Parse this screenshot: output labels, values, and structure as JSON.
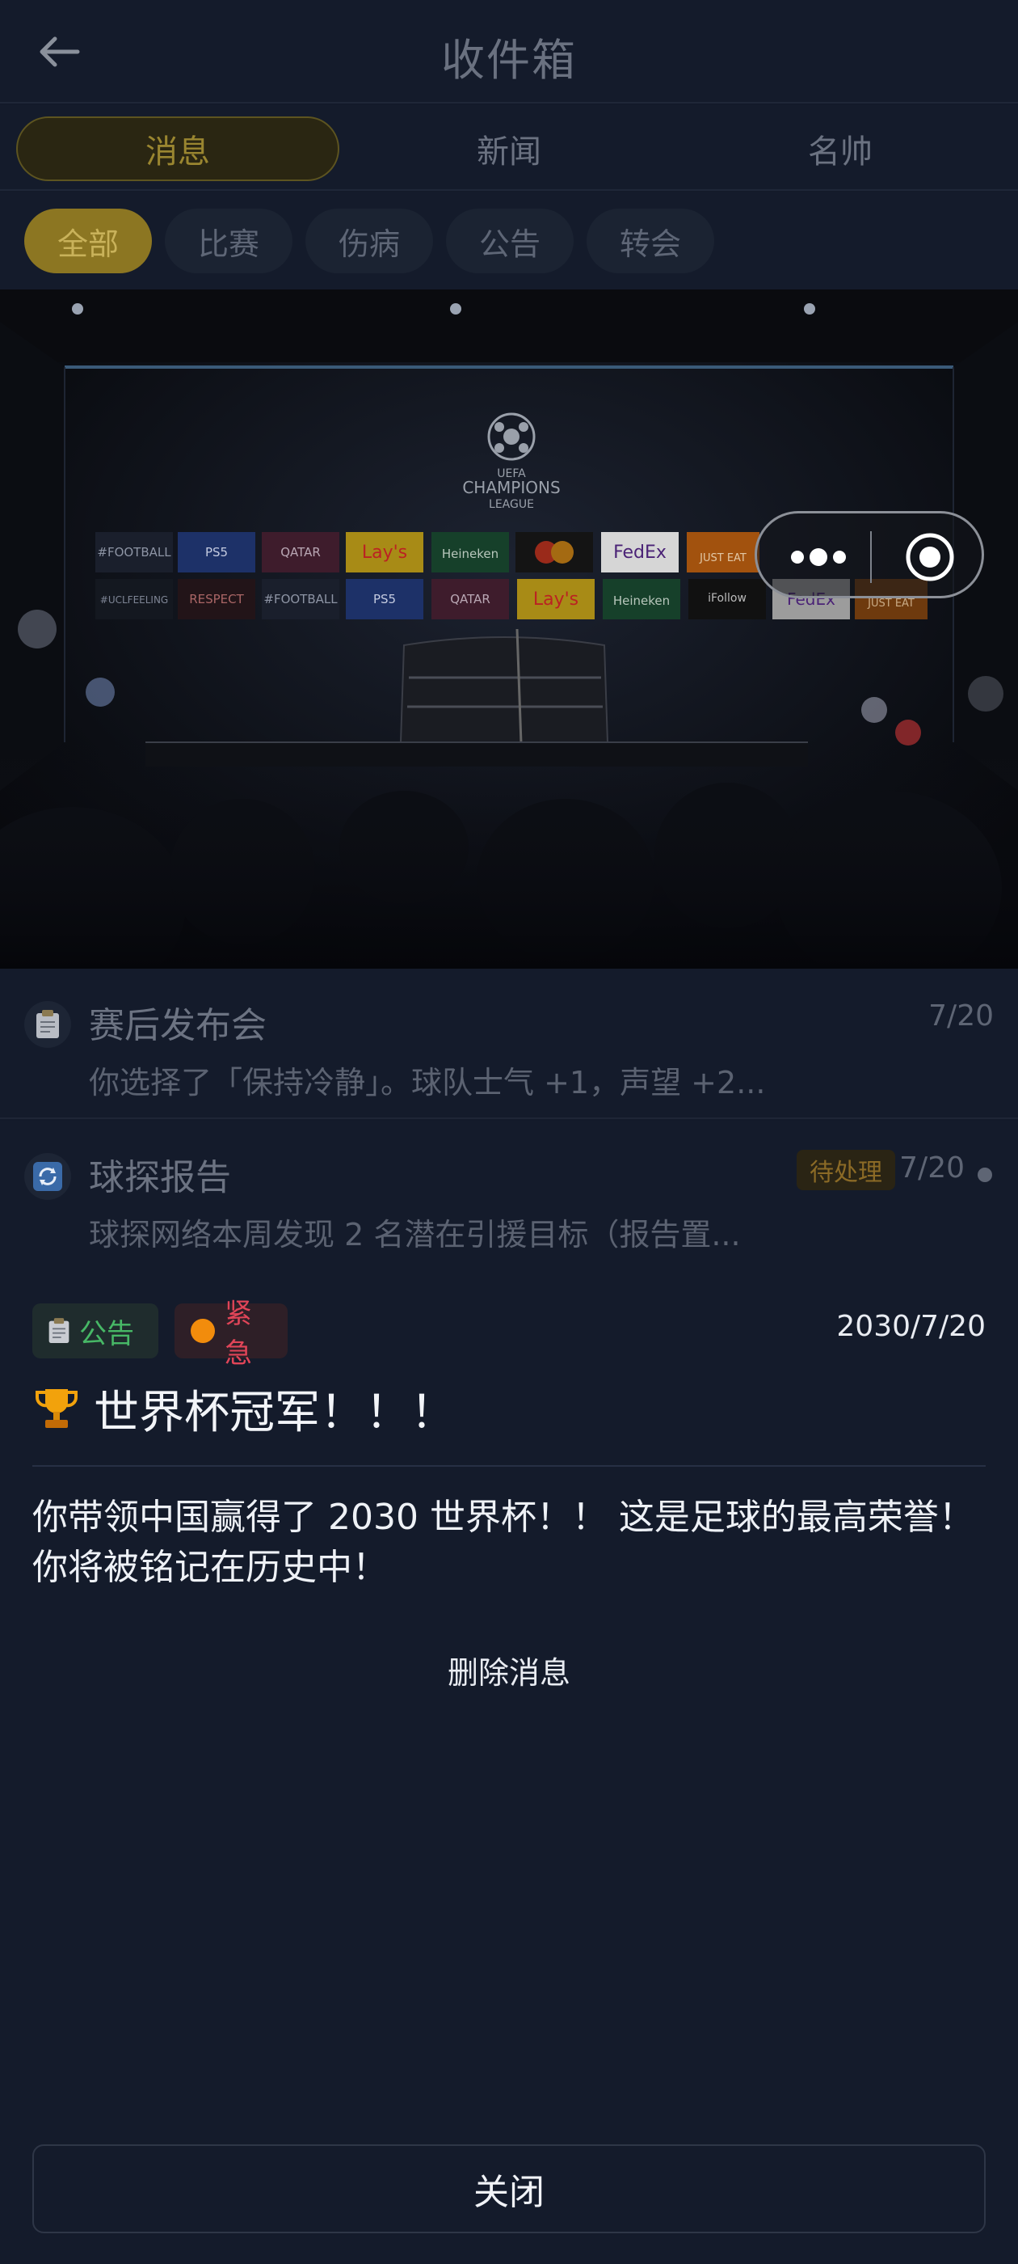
{
  "header": {
    "title": "收件箱",
    "back_icon": "arrow-left-icon"
  },
  "main_tabs": [
    {
      "label": "消息",
      "active": true
    },
    {
      "label": "新闻",
      "active": false
    },
    {
      "label": "名帅",
      "active": false
    }
  ],
  "filters": [
    {
      "label": "全部",
      "active": true
    },
    {
      "label": "比赛",
      "active": false
    },
    {
      "label": "伤病",
      "active": false
    },
    {
      "label": "公告",
      "active": false
    },
    {
      "label": "转会",
      "active": false
    }
  ],
  "hero": {
    "emblem_line1": "UEFA",
    "emblem_line2": "CHAMPIONS",
    "emblem_line3": "LEAGUE",
    "sponsors_row1": [
      "#FOOTBALL",
      "PS5",
      "QATAR AIRWAYS",
      "Lay's",
      "Heineken",
      "",
      "FedEx",
      "JUST EAT"
    ],
    "sponsors_row2": [
      "#THAT #UCLFEELING",
      "RESPECT",
      "#FOOTBALL",
      "PS5",
      "QATAR AIRWAYS",
      "Lay's",
      "Heineken",
      "iFollow Scores",
      "FedEx",
      "JUST EAT"
    ]
  },
  "messages": [
    {
      "title": "赛后发布会",
      "preview": "你选择了「保持冷静」。球队士气 +1，声望 +2...",
      "date": "7/20",
      "icon": "clipboard-icon"
    },
    {
      "title": "球探报告",
      "preview": "球探网络本周发现 2 名潜在引援目标（报告置...",
      "date": "7/20",
      "badge": "待处理",
      "icon": "refresh-icon",
      "unread": true
    }
  ],
  "detail": {
    "tag_notice": "公告",
    "tag_urgent": "紧急",
    "date": "2030/7/20",
    "title": "世界杯冠军！！！",
    "body": "你带领中国赢得了 2030 世界杯！！ 这是足球的最高荣誉！ 你将被铭记在历史中！",
    "delete_label": "删除消息",
    "close_label": "关闭"
  },
  "colors": {
    "background": "#131a2a",
    "accent_gold": "#8c7622",
    "notice_green": "#47b866",
    "urgent_red": "#e04558",
    "urgent_orange": "#f28c0c"
  }
}
